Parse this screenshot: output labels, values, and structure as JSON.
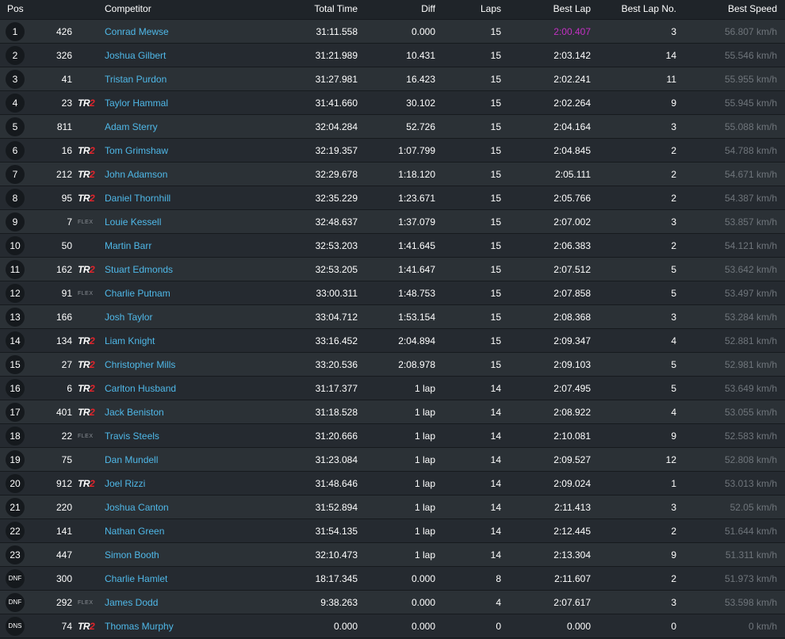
{
  "headers": {
    "pos": "Pos",
    "competitor": "Competitor",
    "total_time": "Total Time",
    "diff": "Diff",
    "laps": "Laps",
    "best_lap": "Best Lap",
    "best_lap_no": "Best Lap No.",
    "best_speed": "Best Speed"
  },
  "class_labels": {
    "tr": "TR",
    "two": "2",
    "flex": "FLEX"
  },
  "colors": {
    "name": "#4fb8e8",
    "fastest_lap": "#c330c3",
    "tr2_red": "#e0242b",
    "row_odd": "#2b3136",
    "row_even": "#252a30"
  },
  "rows": [
    {
      "pos": "1",
      "num": "426",
      "class": "",
      "name": "Conrad Mewse",
      "time": "31:11.558",
      "diff": "0.000",
      "laps": "15",
      "best": "2:00.407",
      "bln": "3",
      "speed": "56.807 km/h",
      "fastest": true
    },
    {
      "pos": "2",
      "num": "326",
      "class": "",
      "name": "Joshua Gilbert",
      "time": "31:21.989",
      "diff": "10.431",
      "laps": "15",
      "best": "2:03.142",
      "bln": "14",
      "speed": "55.546 km/h"
    },
    {
      "pos": "3",
      "num": "41",
      "class": "",
      "name": "Tristan Purdon",
      "time": "31:27.981",
      "diff": "16.423",
      "laps": "15",
      "best": "2:02.241",
      "bln": "11",
      "speed": "55.955 km/h"
    },
    {
      "pos": "4",
      "num": "23",
      "class": "TR2",
      "name": "Taylor Hammal",
      "time": "31:41.660",
      "diff": "30.102",
      "laps": "15",
      "best": "2:02.264",
      "bln": "9",
      "speed": "55.945 km/h"
    },
    {
      "pos": "5",
      "num": "811",
      "class": "",
      "name": "Adam Sterry",
      "time": "32:04.284",
      "diff": "52.726",
      "laps": "15",
      "best": "2:04.164",
      "bln": "3",
      "speed": "55.088 km/h"
    },
    {
      "pos": "6",
      "num": "16",
      "class": "TR2",
      "name": "Tom Grimshaw",
      "time": "32:19.357",
      "diff": "1:07.799",
      "laps": "15",
      "best": "2:04.845",
      "bln": "2",
      "speed": "54.788 km/h"
    },
    {
      "pos": "7",
      "num": "212",
      "class": "TR2",
      "name": "John Adamson",
      "time": "32:29.678",
      "diff": "1:18.120",
      "laps": "15",
      "best": "2:05.111",
      "bln": "2",
      "speed": "54.671 km/h"
    },
    {
      "pos": "8",
      "num": "95",
      "class": "TR2",
      "name": "Daniel Thornhill",
      "time": "32:35.229",
      "diff": "1:23.671",
      "laps": "15",
      "best": "2:05.766",
      "bln": "2",
      "speed": "54.387 km/h"
    },
    {
      "pos": "9",
      "num": "7",
      "class": "FLEX",
      "name": "Louie Kessell",
      "time": "32:48.637",
      "diff": "1:37.079",
      "laps": "15",
      "best": "2:07.002",
      "bln": "3",
      "speed": "53.857 km/h"
    },
    {
      "pos": "10",
      "num": "50",
      "class": "",
      "name": "Martin Barr",
      "time": "32:53.203",
      "diff": "1:41.645",
      "laps": "15",
      "best": "2:06.383",
      "bln": "2",
      "speed": "54.121 km/h"
    },
    {
      "pos": "11",
      "num": "162",
      "class": "TR2",
      "name": "Stuart Edmonds",
      "time": "32:53.205",
      "diff": "1:41.647",
      "laps": "15",
      "best": "2:07.512",
      "bln": "5",
      "speed": "53.642 km/h"
    },
    {
      "pos": "12",
      "num": "91",
      "class": "FLEX",
      "name": "Charlie Putnam",
      "time": "33:00.311",
      "diff": "1:48.753",
      "laps": "15",
      "best": "2:07.858",
      "bln": "5",
      "speed": "53.497 km/h"
    },
    {
      "pos": "13",
      "num": "166",
      "class": "",
      "name": "Josh Taylor",
      "time": "33:04.712",
      "diff": "1:53.154",
      "laps": "15",
      "best": "2:08.368",
      "bln": "3",
      "speed": "53.284 km/h"
    },
    {
      "pos": "14",
      "num": "134",
      "class": "TR2",
      "name": "Liam Knight",
      "time": "33:16.452",
      "diff": "2:04.894",
      "laps": "15",
      "best": "2:09.347",
      "bln": "4",
      "speed": "52.881 km/h"
    },
    {
      "pos": "15",
      "num": "27",
      "class": "TR2",
      "name": "Christopher Mills",
      "time": "33:20.536",
      "diff": "2:08.978",
      "laps": "15",
      "best": "2:09.103",
      "bln": "5",
      "speed": "52.981 km/h"
    },
    {
      "pos": "16",
      "num": "6",
      "class": "TR2",
      "name": "Carlton Husband",
      "time": "31:17.377",
      "diff": "1 lap",
      "laps": "14",
      "best": "2:07.495",
      "bln": "5",
      "speed": "53.649 km/h"
    },
    {
      "pos": "17",
      "num": "401",
      "class": "TR2",
      "name": "Jack Beniston",
      "time": "31:18.528",
      "diff": "1 lap",
      "laps": "14",
      "best": "2:08.922",
      "bln": "4",
      "speed": "53.055 km/h"
    },
    {
      "pos": "18",
      "num": "22",
      "class": "FLEX",
      "name": "Travis Steels",
      "time": "31:20.666",
      "diff": "1 lap",
      "laps": "14",
      "best": "2:10.081",
      "bln": "9",
      "speed": "52.583 km/h"
    },
    {
      "pos": "19",
      "num": "75",
      "class": "",
      "name": "Dan Mundell",
      "time": "31:23.084",
      "diff": "1 lap",
      "laps": "14",
      "best": "2:09.527",
      "bln": "12",
      "speed": "52.808 km/h"
    },
    {
      "pos": "20",
      "num": "912",
      "class": "TR2",
      "name": "Joel Rizzi",
      "time": "31:48.646",
      "diff": "1 lap",
      "laps": "14",
      "best": "2:09.024",
      "bln": "1",
      "speed": "53.013 km/h"
    },
    {
      "pos": "21",
      "num": "220",
      "class": "",
      "name": "Joshua Canton",
      "time": "31:52.894",
      "diff": "1 lap",
      "laps": "14",
      "best": "2:11.413",
      "bln": "3",
      "speed": "52.05 km/h"
    },
    {
      "pos": "22",
      "num": "141",
      "class": "",
      "name": "Nathan Green",
      "time": "31:54.135",
      "diff": "1 lap",
      "laps": "14",
      "best": "2:12.445",
      "bln": "2",
      "speed": "51.644 km/h"
    },
    {
      "pos": "23",
      "num": "447",
      "class": "",
      "name": "Simon Booth",
      "time": "32:10.473",
      "diff": "1 lap",
      "laps": "14",
      "best": "2:13.304",
      "bln": "9",
      "speed": "51.311 km/h"
    },
    {
      "pos": "DNF",
      "num": "300",
      "class": "",
      "name": "Charlie Hamlet",
      "time": "18:17.345",
      "diff": "0.000",
      "laps": "8",
      "best": "2:11.607",
      "bln": "2",
      "speed": "51.973 km/h"
    },
    {
      "pos": "DNF",
      "num": "292",
      "class": "FLEX",
      "name": "James Dodd",
      "time": "9:38.263",
      "diff": "0.000",
      "laps": "4",
      "best": "2:07.617",
      "bln": "3",
      "speed": "53.598 km/h"
    },
    {
      "pos": "DNS",
      "num": "74",
      "class": "TR2",
      "name": "Thomas Murphy",
      "time": "0.000",
      "diff": "0.000",
      "laps": "0",
      "best": "0.000",
      "bln": "0",
      "speed": "0 km/h"
    }
  ]
}
